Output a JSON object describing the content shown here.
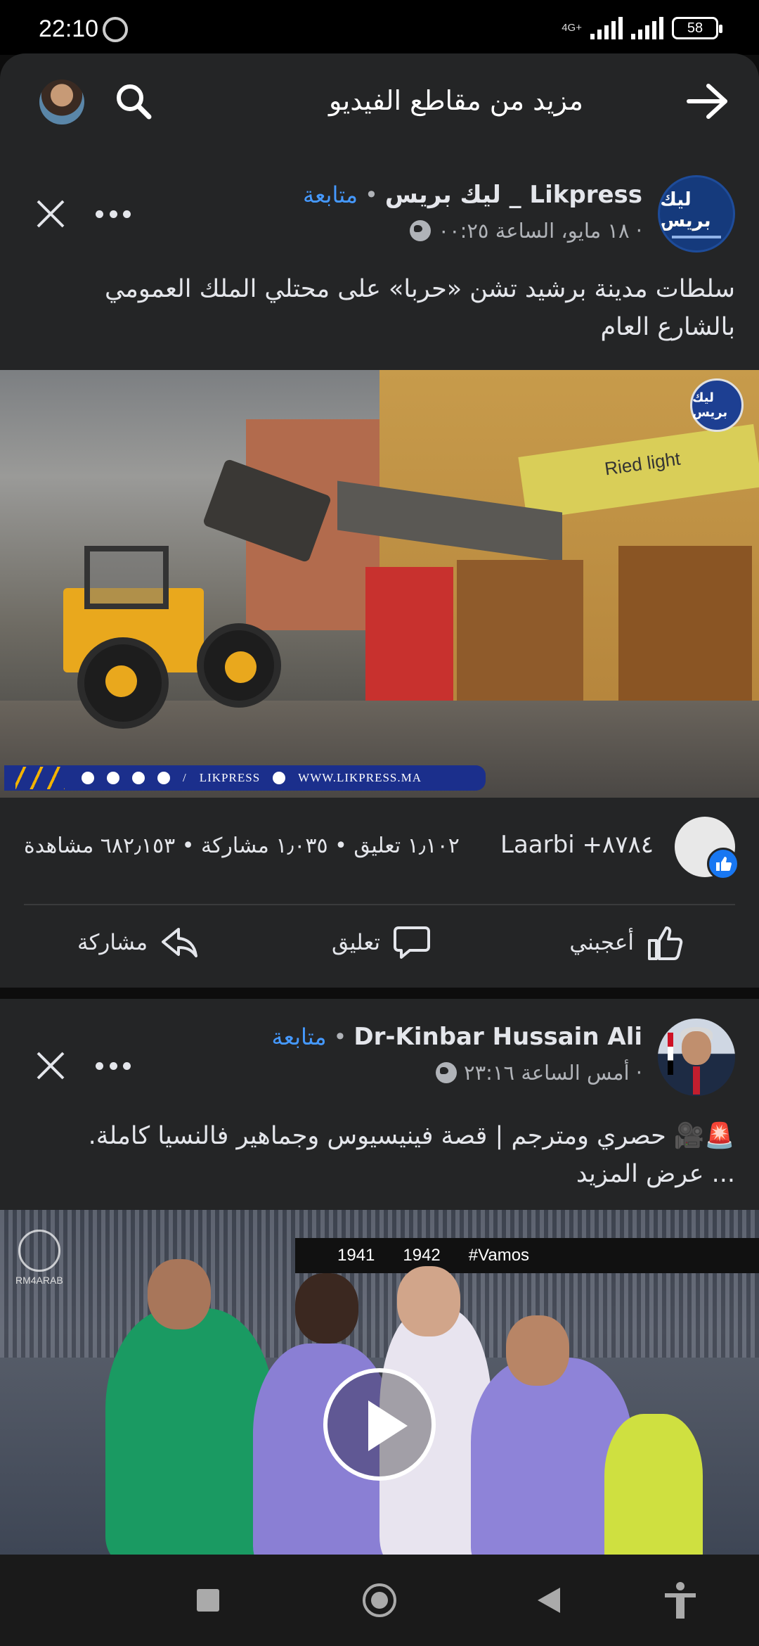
{
  "status_bar": {
    "time": "22:10",
    "network": "4G+",
    "battery": "58"
  },
  "header": {
    "title": "مزيد من مقاطع الفيديو"
  },
  "post1": {
    "page_name": "ليك بريس _ Likpress",
    "follow": "متابعة",
    "date": "١٨ مايو، الساعة ٠٠:٢٥ ·",
    "caption": "سلطات مدينة برشيد تشن «حربا» على محتلي الملك العمومي بالشارع العام",
    "avatar_logo": "ليك بريس",
    "video": {
      "watermark": "ليك بريس",
      "banner_brand": "LIKPRESS",
      "banner_url": "WWW.LIKPRESS.MA",
      "sign": "Ried light"
    },
    "reactions": "Laarbi +٨٧٨٤",
    "counts": "١٫١٠٢ تعليق • ١٫٠٣٥ مشاركة • ٦٨٢٫١٥٣ مشاهدة",
    "actions": {
      "like": "أعجبني",
      "comment": "تعليق",
      "share": "مشاركة"
    }
  },
  "post2": {
    "page_name": "Dr-Kinbar Hussain Ali",
    "follow": "متابعة",
    "date": "أمس الساعة ٢٣:١٦ ·",
    "caption_line1": "🚨🎥 حصري ومترجم | قصة فينيسيوس وجماهير فالنسيا كاملة.",
    "caption_more": "... عرض المزيد",
    "video": {
      "logo_text": "RM4ARAB",
      "board1": "1941",
      "board2": "1942",
      "board3": "#Vamos"
    }
  },
  "colors": {
    "surface": "#242526",
    "background": "#0d0d0d",
    "link": "#4599ff",
    "like_badge": "#1877f2"
  }
}
